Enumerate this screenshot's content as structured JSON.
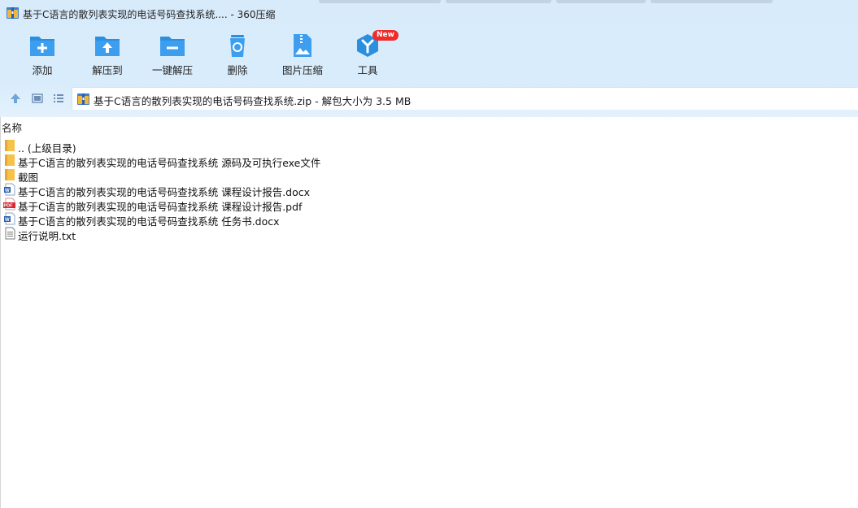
{
  "window": {
    "title": "基于C语言的散列表实现的电话号码查找系统.... - 360压缩"
  },
  "toolbar": {
    "buttons": [
      {
        "label": "添加",
        "icon": "add-icon"
      },
      {
        "label": "解压到",
        "icon": "extract-to-icon"
      },
      {
        "label": "一键解压",
        "icon": "one-click-extract-icon"
      },
      {
        "label": "删除",
        "icon": "delete-icon"
      },
      {
        "label": "图片压缩",
        "icon": "image-compress-icon"
      },
      {
        "label": "工具",
        "icon": "tools-icon",
        "badge": "New"
      }
    ]
  },
  "address": {
    "text": "基于C语言的散列表实现的电话号码查找系统.zip - 解包大小为 3.5 MB"
  },
  "list": {
    "column_name": "名称",
    "files": [
      {
        "name": ".. (上级目录)",
        "type": "folder"
      },
      {
        "name": "基于C语言的散列表实现的电话号码查找系统 源码及可执行exe文件",
        "type": "folder"
      },
      {
        "name": "截图",
        "type": "folder"
      },
      {
        "name": "基于C语言的散列表实现的电话号码查找系统 课程设计报告.docx",
        "type": "docx"
      },
      {
        "name": "基于C语言的散列表实现的电话号码查找系统 课程设计报告.pdf",
        "type": "pdf"
      },
      {
        "name": "基于C语言的散列表实现的电话号码查找系统 任务书.docx",
        "type": "docx"
      },
      {
        "name": "运行说明.txt",
        "type": "txt"
      }
    ]
  },
  "colors": {
    "accent": "#2b8fe0",
    "band": "#d8ebfb",
    "badge": "#ef2b2b",
    "folder": "#f6c24a",
    "pdf": "#d9282f"
  }
}
